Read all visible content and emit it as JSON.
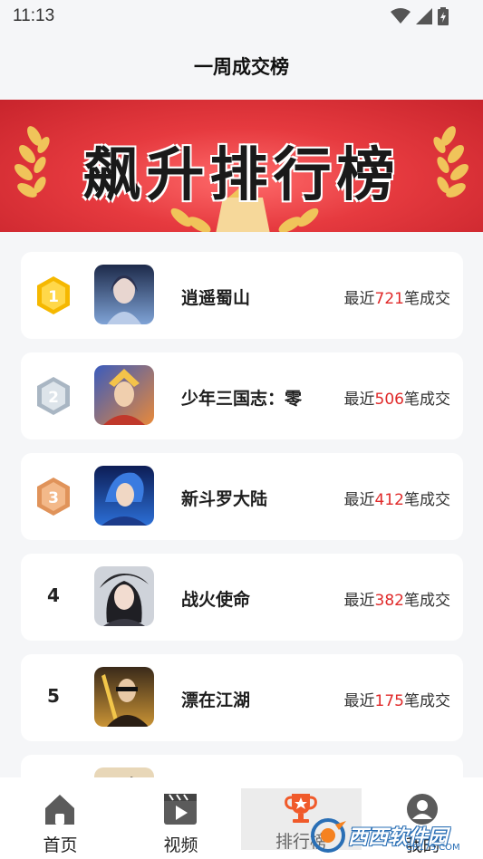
{
  "status": {
    "time": "11:13"
  },
  "header": {
    "title": "一周成交榜"
  },
  "banner": {
    "title": "飙升排行榜"
  },
  "ranks": [
    {
      "rank": "1",
      "name": "逍遥蜀山",
      "prefix": "最近",
      "count": "721",
      "suffix": "笔成交",
      "badge": "gold"
    },
    {
      "rank": "2",
      "name": "少年三国志：零",
      "prefix": "最近",
      "count": "506",
      "suffix": "笔成交",
      "badge": "silver"
    },
    {
      "rank": "3",
      "name": "新斗罗大陆",
      "prefix": "最近",
      "count": "412",
      "suffix": "笔成交",
      "badge": "bronze"
    },
    {
      "rank": "4",
      "name": "战火使命",
      "prefix": "最近",
      "count": "382",
      "suffix": "笔成交"
    },
    {
      "rank": "5",
      "name": "漂在江湖",
      "prefix": "最近",
      "count": "175",
      "suffix": "笔成交"
    }
  ],
  "tabs": [
    {
      "label": "首页",
      "icon": "home-icon"
    },
    {
      "label": "视频",
      "icon": "video-icon"
    },
    {
      "label": "排行榜",
      "icon": "trophy-icon",
      "active": true
    },
    {
      "label": "我的",
      "icon": "user-icon"
    }
  ],
  "watermark": {
    "brand": "西西软件园",
    "domain": "CR173.COM"
  },
  "colors": {
    "accent": "#e02a2a",
    "banner": "#e63a3f",
    "gold": "#f5b800",
    "silver": "#a9b6c3",
    "bronze": "#e0935a"
  }
}
